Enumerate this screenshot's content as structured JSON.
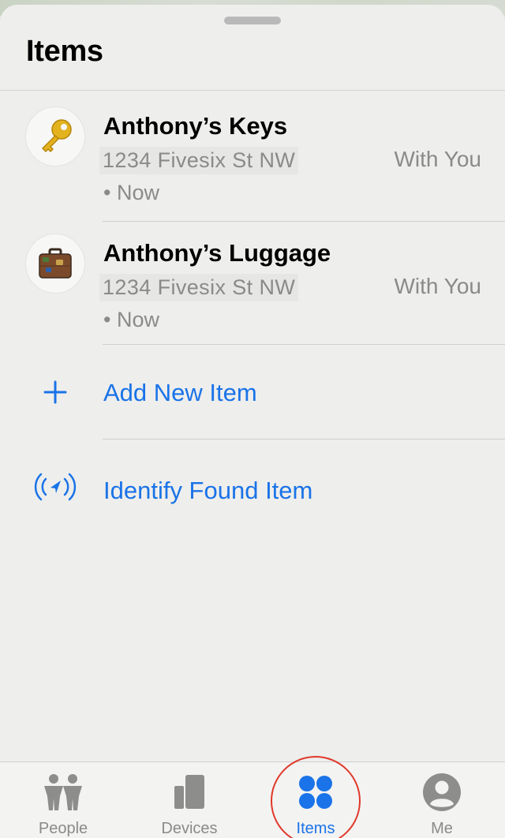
{
  "header": {
    "title": "Items"
  },
  "items": [
    {
      "name": "Anthony’s Keys",
      "address": "1234 Fivesix St NW",
      "time": "• Now",
      "status": "With You",
      "icon": "key-icon"
    },
    {
      "name": "Anthony’s Luggage",
      "address": "1234 Fivesix St NW",
      "time": "• Now",
      "status": "With You",
      "icon": "luggage-icon"
    }
  ],
  "actions": {
    "add_new": {
      "label": "Add New Item",
      "icon": "plus-icon"
    },
    "identify_found": {
      "label": "Identify Found Item",
      "icon": "found-item-signal-icon"
    }
  },
  "tabbar": {
    "tabs": [
      {
        "label": "People",
        "icon": "people-icon"
      },
      {
        "label": "Devices",
        "icon": "devices-icon"
      },
      {
        "label": "Items",
        "icon": "items-icon",
        "active": true
      },
      {
        "label": "Me",
        "icon": "me-icon"
      }
    ]
  },
  "colors": {
    "accent": "#1a73e8",
    "highlight_ring": "#e0392b",
    "secondary_text": "#8a8a8a"
  }
}
